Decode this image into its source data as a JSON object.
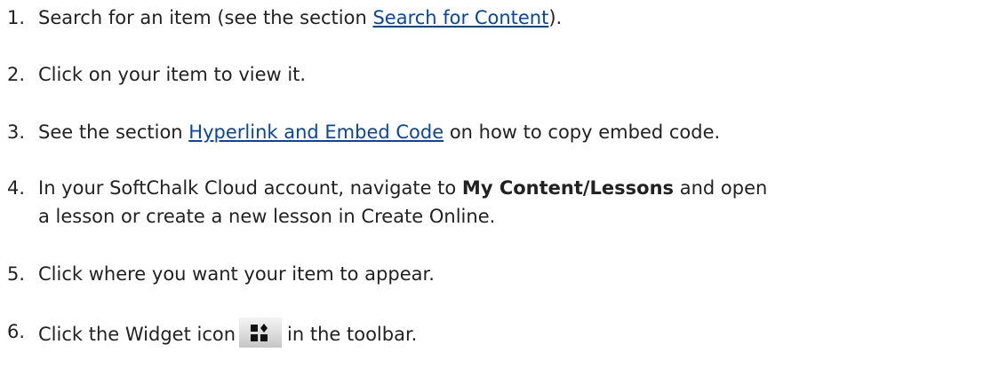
{
  "steps": [
    {
      "number": "1.",
      "pre": "Search for an item (see the section ",
      "link": "Search for Content",
      "post": ")."
    },
    {
      "number": "2.",
      "text": "Click on your item to view it."
    },
    {
      "number": "3.",
      "pre": "See the section ",
      "link": "Hyperlink and Embed Code",
      "post": " on how to copy embed code."
    },
    {
      "number": "4.",
      "pre": "In your SoftChalk Cloud account, navigate to ",
      "bold": "My Content/Lessons",
      "post": " and open",
      "line2": "a lesson or create a new lesson in Create Online."
    },
    {
      "number": "5.",
      "text": "Click where you want your item to appear."
    },
    {
      "number": "6.",
      "pre": "Click the Widget icon",
      "icon": "widget-icon",
      "post": "in the toolbar."
    }
  ]
}
